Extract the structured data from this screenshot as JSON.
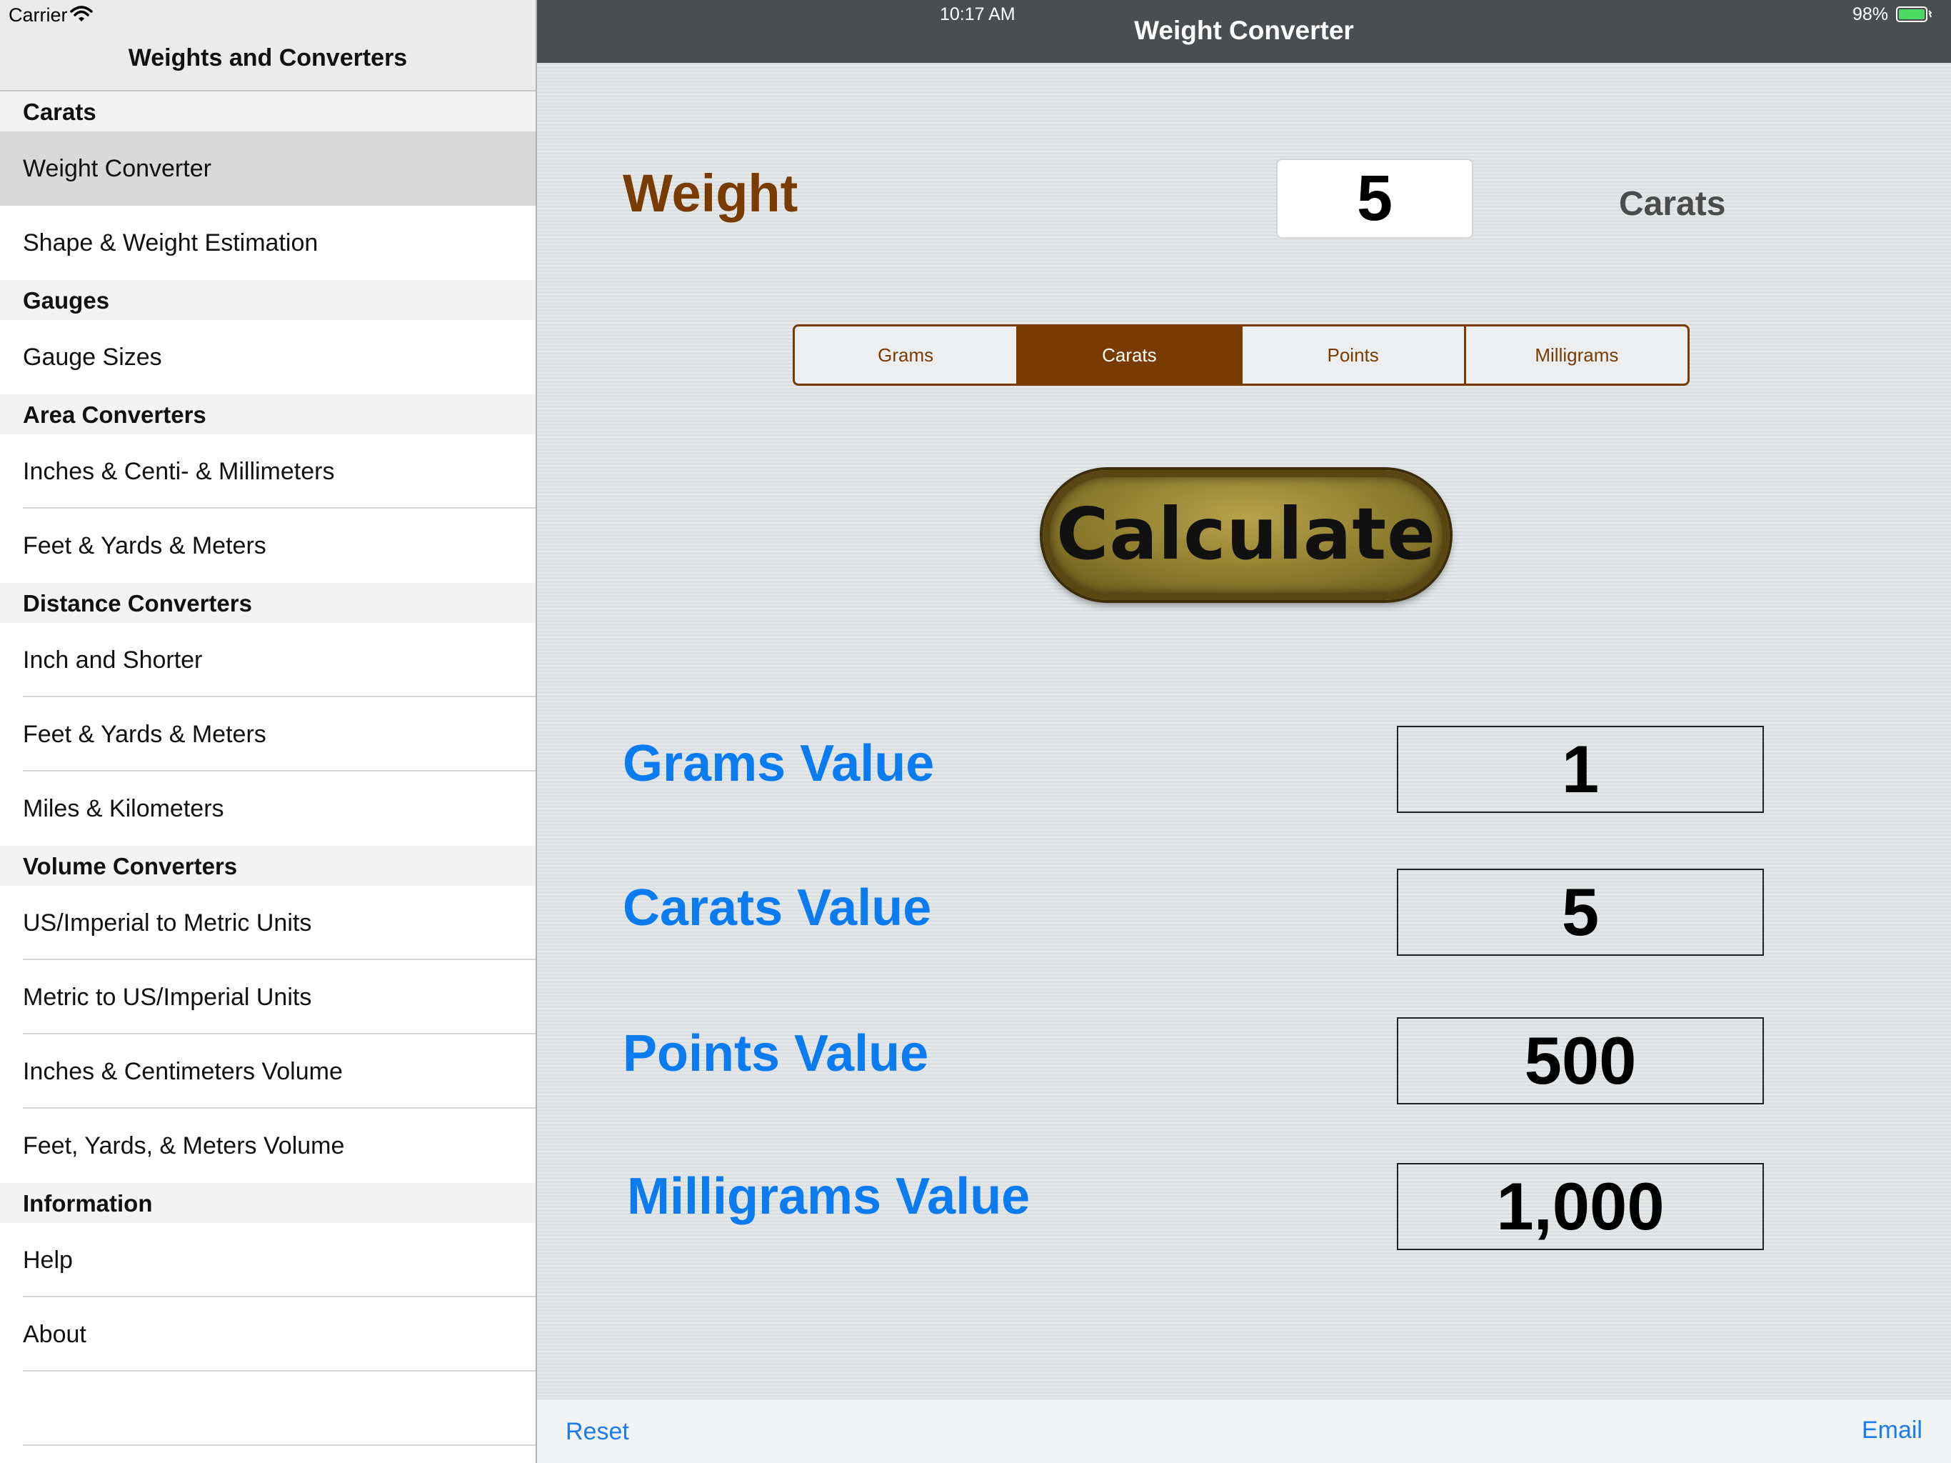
{
  "status": {
    "carrier": "Carrier",
    "time": "10:17 AM",
    "battery": "98%"
  },
  "sidebar": {
    "title": "Weights and Converters",
    "sections": [
      {
        "header": "Carats",
        "items": [
          {
            "label": "Weight Converter",
            "selected": true
          },
          {
            "label": "Shape & Weight Estimation"
          }
        ]
      },
      {
        "header": "Gauges",
        "items": [
          {
            "label": "Gauge Sizes"
          }
        ]
      },
      {
        "header": "Area Converters",
        "items": [
          {
            "label": "Inches & Centi- & Millimeters"
          },
          {
            "label": "Feet & Yards & Meters"
          }
        ]
      },
      {
        "header": "Distance Converters",
        "items": [
          {
            "label": "Inch and Shorter"
          },
          {
            "label": "Feet & Yards & Meters"
          },
          {
            "label": "Miles & Kilometers"
          }
        ]
      },
      {
        "header": "Volume Converters",
        "items": [
          {
            "label": "US/Imperial to Metric Units"
          },
          {
            "label": "Metric to US/Imperial Units"
          },
          {
            "label": "Inches & Centimeters Volume"
          },
          {
            "label": "Feet, Yards, & Meters Volume"
          }
        ]
      },
      {
        "header": "Information",
        "items": [
          {
            "label": "Help"
          },
          {
            "label": "About"
          },
          {
            "label": ""
          }
        ]
      }
    ]
  },
  "detail": {
    "nav_title": "Weight Converter",
    "weight_label": "Weight",
    "weight_value": "5",
    "weight_unit": "Carats",
    "segments": [
      "Grams",
      "Carats",
      "Points",
      "Milligrams"
    ],
    "selected_segment": "Carats",
    "calculate_label": "Calculate",
    "results": [
      {
        "label": "Grams Value",
        "value": "1"
      },
      {
        "label": "Carats Value",
        "value": "5"
      },
      {
        "label": "Points Value",
        "value": "500"
      },
      {
        "label": "Milligrams Value",
        "value": "1,000"
      }
    ],
    "toolbar": {
      "reset": "Reset",
      "email": "Email"
    }
  },
  "colors": {
    "accent_brown": "#7a3b00",
    "link_blue": "#1a7cf0",
    "result_blue": "#0a7bf0",
    "navbar": "#4b4e50",
    "battery_green": "#4cd964"
  }
}
